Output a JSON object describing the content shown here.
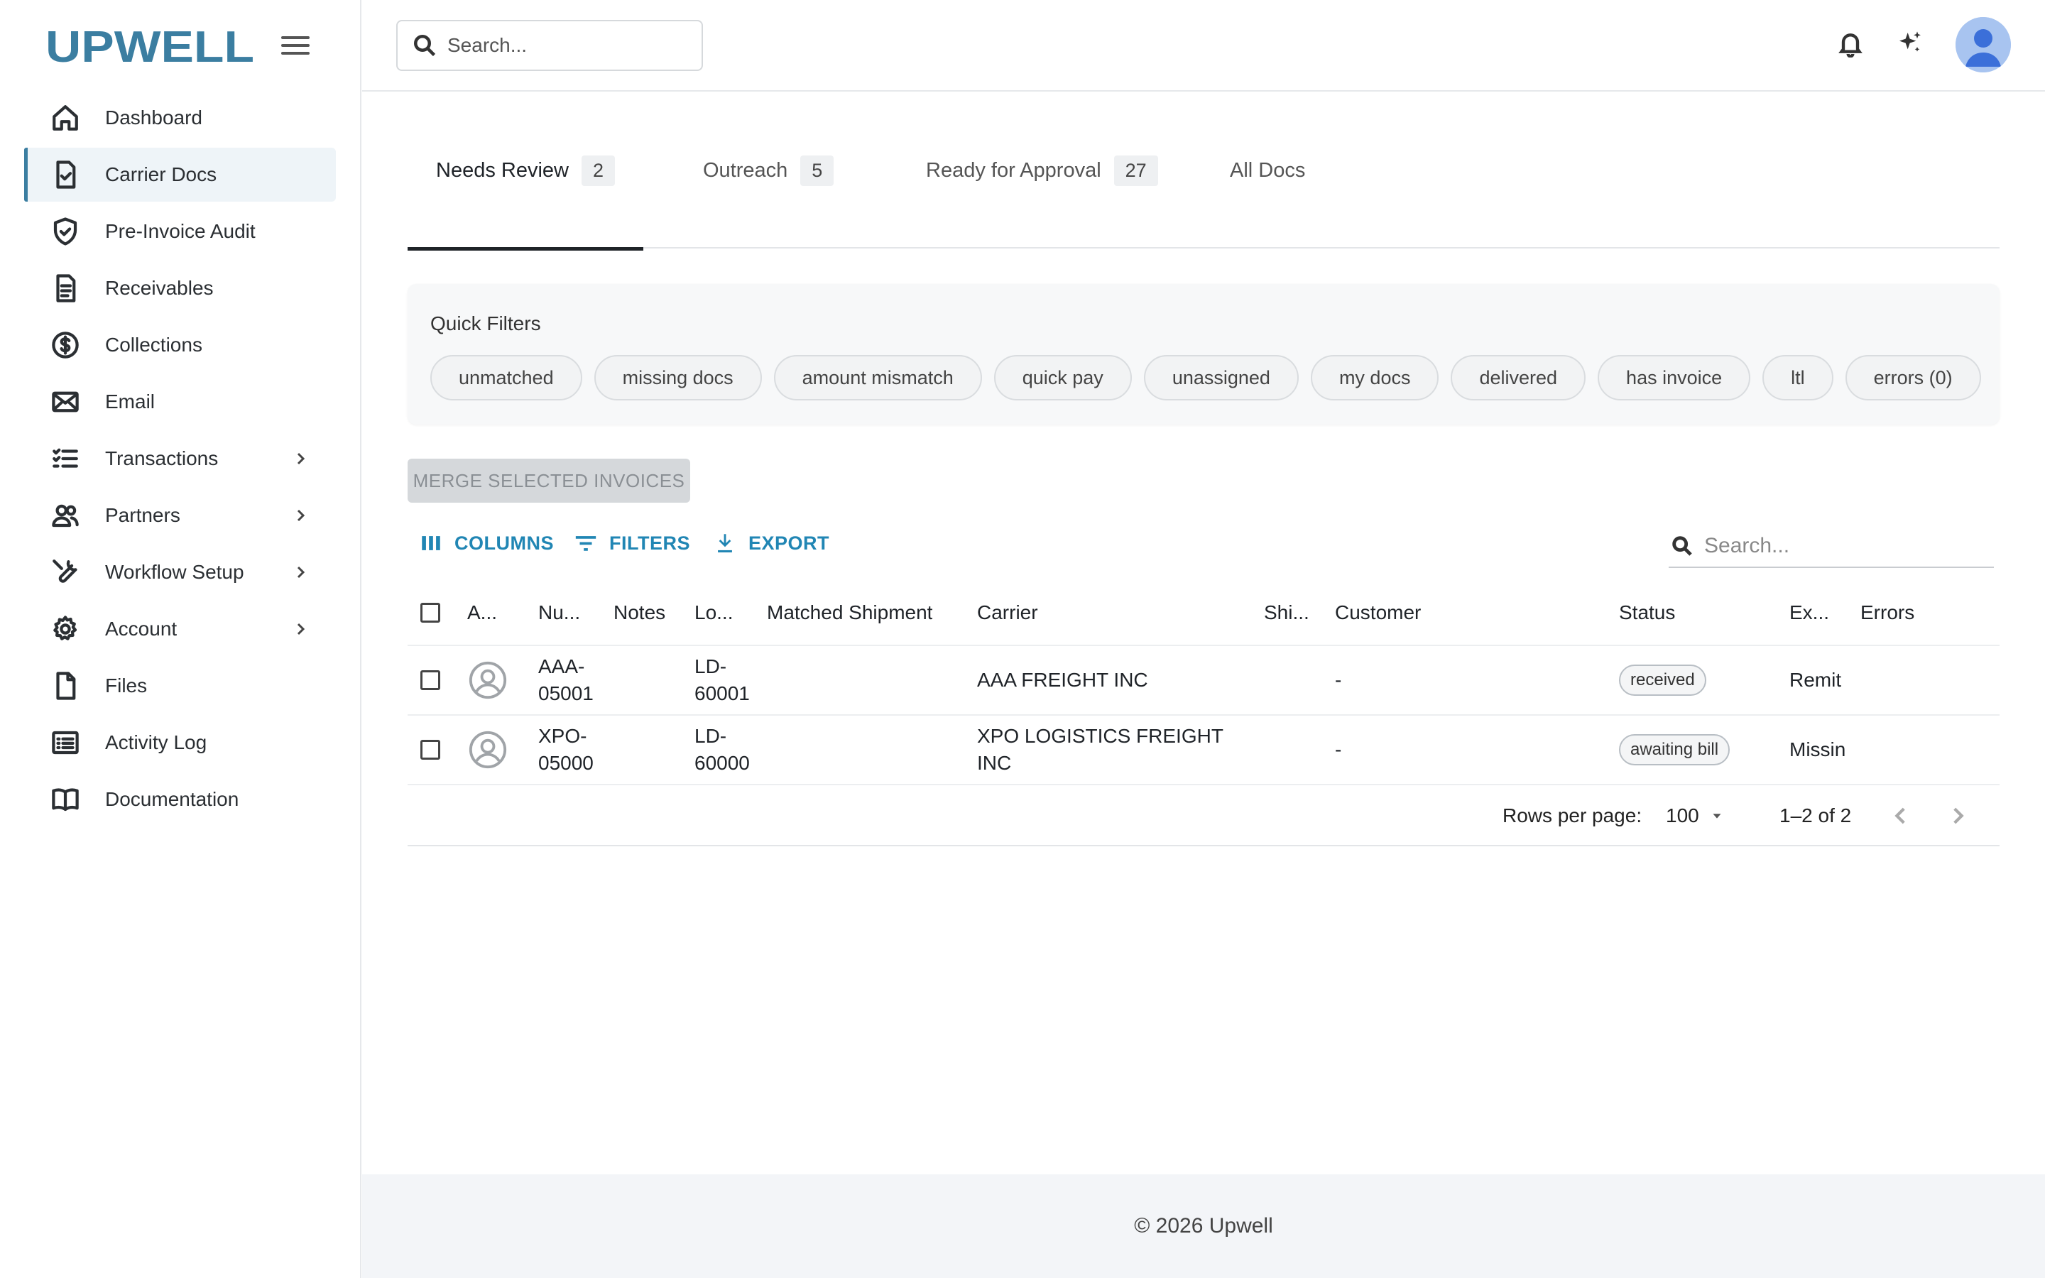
{
  "brand": {
    "name": "UPWELL",
    "color": "#3b7ea1"
  },
  "topbar": {
    "search_placeholder": "Search..."
  },
  "sidebar": {
    "items": [
      {
        "label": "Dashboard",
        "icon": "home-icon"
      },
      {
        "label": "Carrier Docs",
        "icon": "doc-check-icon",
        "active": true
      },
      {
        "label": "Pre-Invoice Audit",
        "icon": "shield-check-icon"
      },
      {
        "label": "Receivables",
        "icon": "receipt-icon"
      },
      {
        "label": "Collections",
        "icon": "dollar-circle-icon"
      },
      {
        "label": "Email",
        "icon": "mail-icon"
      },
      {
        "label": "Transactions",
        "icon": "list-check-icon",
        "expandable": true
      },
      {
        "label": "Partners",
        "icon": "users-icon",
        "expandable": true
      },
      {
        "label": "Workflow Setup",
        "icon": "wrench-icon",
        "expandable": true
      },
      {
        "label": "Account",
        "icon": "gear-icon",
        "expandable": true
      },
      {
        "label": "Files",
        "icon": "file-icon"
      },
      {
        "label": "Activity Log",
        "icon": "activity-list-icon"
      },
      {
        "label": "Documentation",
        "icon": "book-icon"
      }
    ]
  },
  "tabs": [
    {
      "label": "Needs Review",
      "count": "2",
      "active": true
    },
    {
      "label": "Outreach",
      "count": "5"
    },
    {
      "label": "Ready for Approval",
      "count": "27"
    },
    {
      "label": "All Docs",
      "count": ""
    }
  ],
  "quick_filters": {
    "title": "Quick Filters",
    "chips": [
      "unmatched",
      "missing docs",
      "amount mismatch",
      "quick pay",
      "unassigned",
      "my docs",
      "delivered",
      "has invoice",
      "ltl",
      "errors (0)"
    ]
  },
  "merge_button": "MERGE SELECTED INVOICES",
  "grid": {
    "toolbar": {
      "columns": "COLUMNS",
      "filters": "FILTERS",
      "export": "EXPORT",
      "search_placeholder": "Search..."
    },
    "headers": {
      "assignee": "A...",
      "number": "Nu...",
      "notes": "Notes",
      "load": "Lo...",
      "matched": "Matched Shipment",
      "carrier": "Carrier",
      "ship": "Shi...",
      "customer": "Customer",
      "status": "Status",
      "ex": "Ex...",
      "errors": "Errors"
    },
    "rows": [
      {
        "number": "AAA-05001",
        "load": "LD-60001",
        "carrier": "AAA FREIGHT INC",
        "customer": "-",
        "status": "received",
        "ex": "Remit"
      },
      {
        "number": "XPO-05000",
        "load": "LD-60000",
        "carrier": "XPO LOGISTICS FREIGHT INC",
        "customer": "-",
        "status": "awaiting bill",
        "ex": "Missin"
      }
    ],
    "pager": {
      "rows_label": "Rows per page:",
      "rows_value": "100",
      "range": "1–2 of 2"
    }
  },
  "footer": {
    "text": "© 2026 Upwell"
  }
}
